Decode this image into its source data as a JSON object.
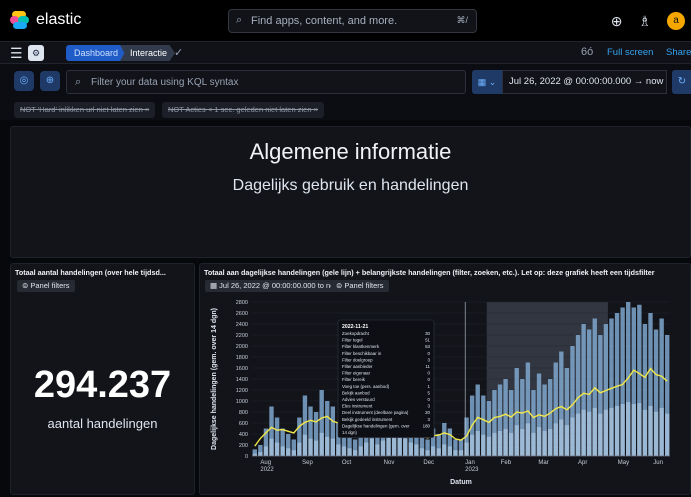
{
  "app": {
    "name": "elastic"
  },
  "search": {
    "placeholder": "Find apps, content, and more.",
    "shortcut": "⌘/"
  },
  "breadcrumbs": {
    "dashboard": "Dashboard",
    "current": "Interactie"
  },
  "header_actions": {
    "fullscreen": "Full screen",
    "share": "Share"
  },
  "user": {
    "initial": "a"
  },
  "query": {
    "placeholder": "Filter your data using KQL syntax"
  },
  "time": {
    "range": "Jul 26, 2022 @ 00:00:00.000  →  now"
  },
  "filters": [
    "NOT 'Hard' inlikken url niet laten zien ×",
    "NOT Acties < 1 sec. geleden niet laten zien ×"
  ],
  "markdown": {
    "title": "Algemene informatie",
    "subtitle": "Dagelijks gebruik en handelingen"
  },
  "metric_panel": {
    "title": "Totaal aantal handelingen (over hele tijdsd...",
    "filters_label": "⊜ Panel filters",
    "value": "294.237",
    "label": "aantal handelingen"
  },
  "chart_panel": {
    "title": "Totaal aan dagelijkse handelingen (gele lijn) + belangrijkste handelingen (filter, zoeken, etc.). Let op: deze grafiek heeft een tijdsfilter",
    "time_chip": "▦ Jul 26, 2022 @ 00:00:00.000 to now",
    "filters_label": "⊜ Panel filters"
  },
  "tooltip": {
    "date": "2022-11-21",
    "rows": [
      {
        "label": "Zoekopdracht",
        "value": "30"
      },
      {
        "label": "Filter tegel",
        "value": "51"
      },
      {
        "label": "Filter klantkenmerk",
        "value": "53"
      },
      {
        "label": "Filter beschikbaar in",
        "value": "0"
      },
      {
        "label": "Filter doelgroep",
        "value": "3"
      },
      {
        "label": "Filter aanbieder",
        "value": "11"
      },
      {
        "label": "Filter eigenaar",
        "value": "0"
      },
      {
        "label": "Filter bereik",
        "value": "0"
      },
      {
        "label": "Voeg toe (pers. aanbod)",
        "value": "1"
      },
      {
        "label": "Bekijk aanbod",
        "value": "5"
      },
      {
        "label": "Advies verstuurd",
        "value": "0"
      },
      {
        "label": "Eles instrument",
        "value": "3"
      },
      {
        "label": "Deel instrument (deelbare pagina)",
        "value": "20"
      },
      {
        "label": "Bekijk gedeeld instrument",
        "value": "3"
      },
      {
        "label": "Dagelijkse handelingen (gem. over",
        "value": "180"
      },
      {
        "label": "14 dgn)",
        "value": ""
      }
    ]
  },
  "chart_data": {
    "type": "bar",
    "title": "",
    "xlabel": "Datum",
    "ylabel": "Dagelijkse handelingen (gem. over 14 dgn)",
    "ylim": [
      0,
      2800
    ],
    "yticks": [
      0,
      200,
      400,
      600,
      800,
      1000,
      1200,
      1400,
      1600,
      1800,
      2000,
      2200,
      2400,
      2600,
      2800
    ],
    "x_tick_labels": [
      "Aug\n2022",
      "Sep",
      "Oct",
      "Nov",
      "Dec",
      "Jan\n2023",
      "Feb",
      "Mar",
      "Apr",
      "May",
      "Jun"
    ],
    "x_tick_fractions": [
      0.02,
      0.12,
      0.215,
      0.315,
      0.41,
      0.51,
      0.595,
      0.685,
      0.78,
      0.875,
      0.96
    ],
    "highlight_range": {
      "start": "Feb 2023",
      "end": "mid May 2023"
    },
    "crosshair_date": "Jan 2023",
    "series": [
      {
        "name": "Dagelijkse handelingen (gem. over 14 dgn)",
        "kind": "line",
        "color": "#f2e84a",
        "values": [
          180,
          320,
          420,
          520,
          470,
          480,
          450,
          420,
          540,
          610,
          650,
          620,
          690,
          720,
          630,
          600,
          500,
          480,
          410,
          430,
          470,
          520,
          560,
          520,
          610,
          860,
          780,
          700,
          660,
          470,
          360,
          330,
          370,
          380,
          420,
          390,
          310,
          290,
          360,
          560,
          700,
          660,
          610,
          700,
          720,
          760,
          710,
          800,
          780,
          820,
          700,
          750,
          720,
          780,
          860,
          900,
          840,
          930,
          1060,
          1140,
          1120,
          1240,
          1150,
          1190,
          1230,
          1270,
          1300,
          1420,
          1560,
          1500,
          1430,
          1590,
          1480,
          1450,
          1360
        ]
      },
      {
        "name": "Handelingen",
        "kind": "bar",
        "color": "#7fa7cf",
        "values": [
          120,
          200,
          500,
          900,
          700,
          500,
          400,
          300,
          700,
          1100,
          900,
          800,
          1200,
          1000,
          900,
          600,
          500,
          400,
          300,
          500,
          700,
          900,
          600,
          800,
          1100,
          1600,
          1300,
          900,
          700,
          600,
          400,
          300,
          500,
          400,
          600,
          500,
          300,
          300,
          700,
          1100,
          1300,
          1100,
          1000,
          1200,
          1300,
          1400,
          1200,
          1600,
          1400,
          1700,
          1200,
          1500,
          1300,
          1400,
          1700,
          1900,
          1600,
          2000,
          2200,
          2400,
          2300,
          2500,
          2200,
          2400,
          2500,
          2600,
          2700,
          2800,
          2700,
          2750,
          2400,
          2600,
          2300,
          2500,
          2200
        ]
      }
    ]
  },
  "colors": {
    "accent": "#36a2ef",
    "line": "#f2e84a",
    "bars": "#7fa7cf"
  }
}
